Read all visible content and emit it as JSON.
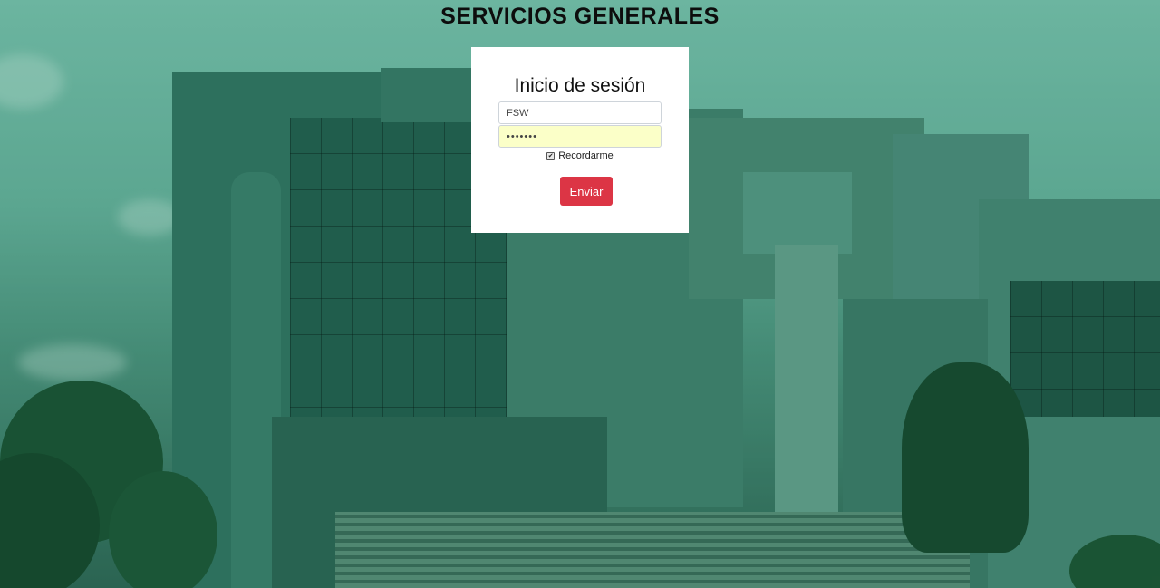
{
  "header": {
    "title": "SERVICIOS GENERALES"
  },
  "login": {
    "title": "Inicio de sesión",
    "username_value": "FSW",
    "password_value": "•••••••",
    "remember_label": "Recordarme",
    "remember_checked": true,
    "submit_label": "Enviar"
  },
  "colors": {
    "accent": "#dc3545",
    "password_autofill": "#fbffc8"
  }
}
